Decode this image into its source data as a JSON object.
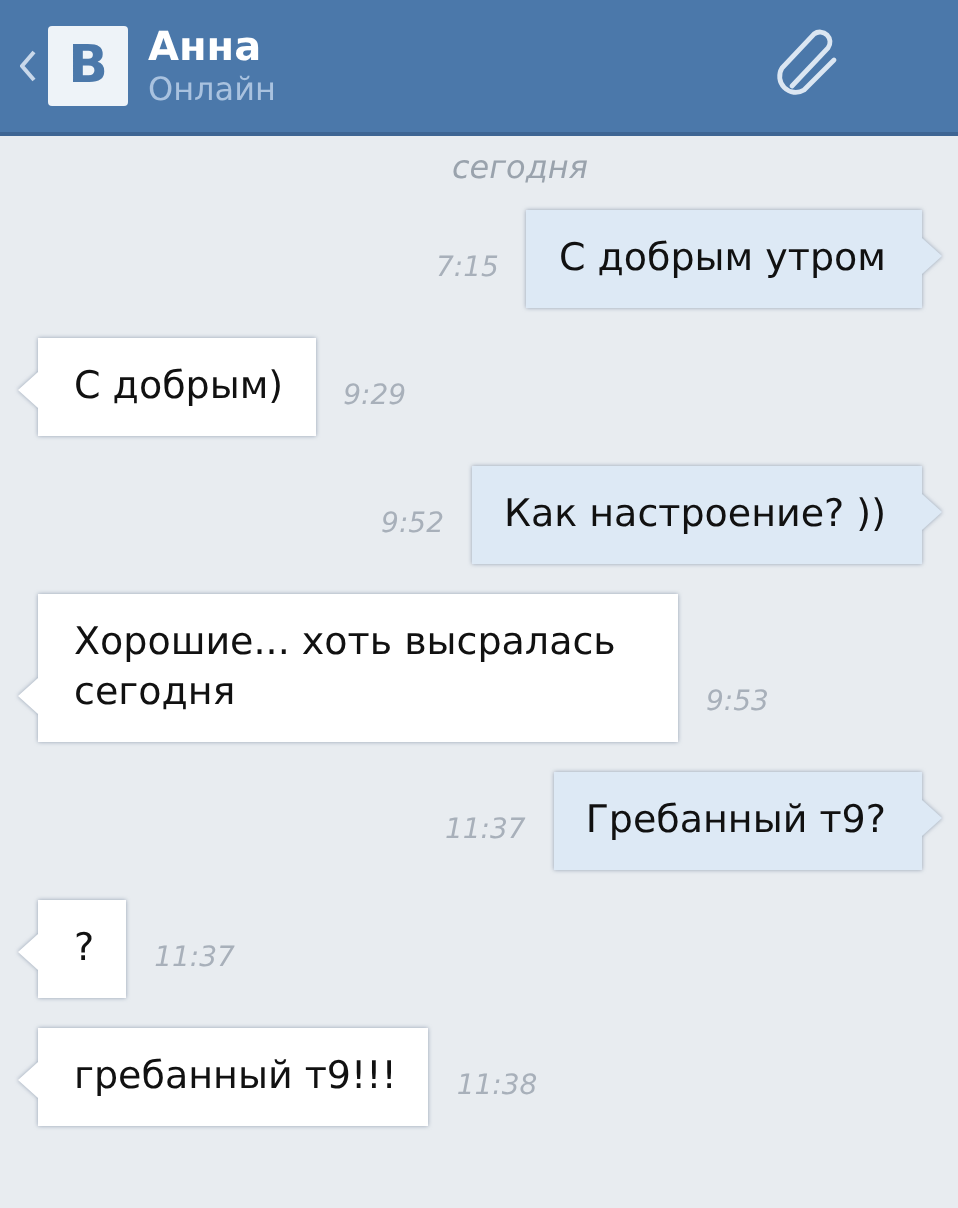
{
  "header": {
    "logo": "В",
    "name": "Анна",
    "status": "Онлайн"
  },
  "date_separator": "сегодня",
  "messages": [
    {
      "kind": "outgoing",
      "text": "С добрым утром",
      "time": "7:15"
    },
    {
      "kind": "incoming",
      "text": "С добрым)",
      "time": "9:29"
    },
    {
      "kind": "outgoing",
      "text": "Как настроение? ))",
      "time": "9:52"
    },
    {
      "kind": "incoming",
      "text": "Хорошие... хоть высралась сегодня",
      "time": "9:53"
    },
    {
      "kind": "outgoing",
      "text": "Гребанный т9?",
      "time": "11:37"
    },
    {
      "kind": "incoming",
      "text": "?",
      "time": "11:37"
    },
    {
      "kind": "incoming",
      "text": "гребанный т9!!!",
      "time": "11:38"
    }
  ]
}
